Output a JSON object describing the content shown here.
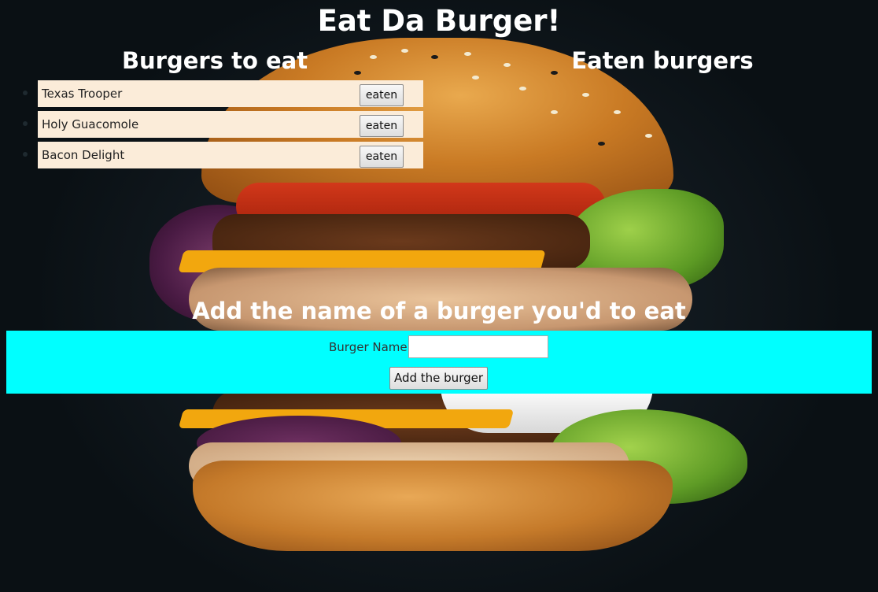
{
  "page": {
    "title": "Eat Da Burger!"
  },
  "columns": {
    "to_eat_title": "Burgers to eat",
    "eaten_title": "Eaten burgers"
  },
  "burgers_to_eat": [
    {
      "name": "Texas Trooper",
      "button_label": "eaten"
    },
    {
      "name": "Holy Guacomole",
      "button_label": "eaten"
    },
    {
      "name": "Bacon Delight",
      "button_label": "eaten"
    }
  ],
  "add_form": {
    "heading": "Add the name of a burger you'd to eat",
    "label": "Burger Name:",
    "input_value": "",
    "submit_label": "Add the burger"
  },
  "colors": {
    "form_panel": "#00ffff",
    "list_item_bg": "#fbecd9",
    "heading_text": "#ffffff"
  }
}
